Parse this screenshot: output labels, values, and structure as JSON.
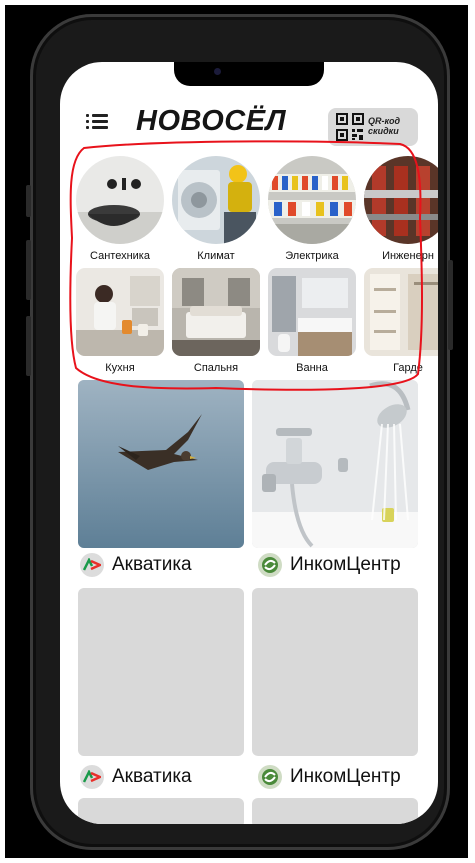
{
  "app": {
    "title": "НОВОСЁЛ",
    "qr_button_label": "QR-код скидки"
  },
  "categories": [
    {
      "label": "Сантехника"
    },
    {
      "label": "Климат"
    },
    {
      "label": "Электрика"
    },
    {
      "label": "Инженерн"
    }
  ],
  "rooms": [
    {
      "label": "Кухня"
    },
    {
      "label": "Спальня"
    },
    {
      "label": "Ванна"
    },
    {
      "label": "Гарде"
    }
  ],
  "products": [
    {
      "brand": "Акватика"
    },
    {
      "brand": "ИнкомЦентр"
    },
    {
      "brand": "Акватика"
    },
    {
      "brand": "ИнкомЦентр"
    }
  ],
  "colors": {
    "annotation": "#e8121b",
    "placeholder": "#d9d9d9",
    "inkom_green": "#4a8a3a"
  }
}
